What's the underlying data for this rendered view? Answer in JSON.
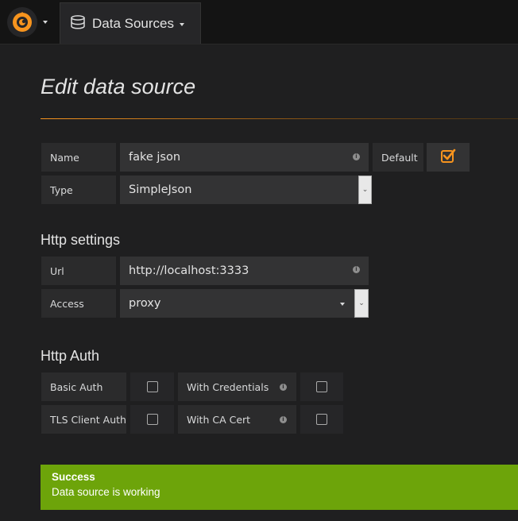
{
  "nav": {
    "breadcrumb_label": "Data Sources"
  },
  "page": {
    "title": "Edit data source"
  },
  "form": {
    "name_label": "Name",
    "name_value": "fake json",
    "default_label": "Default",
    "type_label": "Type",
    "type_value": "SimpleJson"
  },
  "http": {
    "section_title": "Http settings",
    "url_label": "Url",
    "url_value": "http://localhost:3333",
    "access_label": "Access",
    "access_value": "proxy"
  },
  "auth": {
    "section_title": "Http Auth",
    "basic_auth_label": "Basic Auth",
    "with_credentials_label": "With Credentials",
    "tls_client_auth_label": "TLS Client Auth",
    "with_ca_cert_label": "With CA Cert"
  },
  "alert": {
    "title": "Success",
    "message": "Data source is working"
  },
  "colors": {
    "accent": "#f7941e",
    "success": "#6da40a"
  },
  "icons": {
    "logo": "grafana-logo-icon",
    "database": "database-icon",
    "info": "info-icon",
    "check": "checkmark-icon"
  }
}
